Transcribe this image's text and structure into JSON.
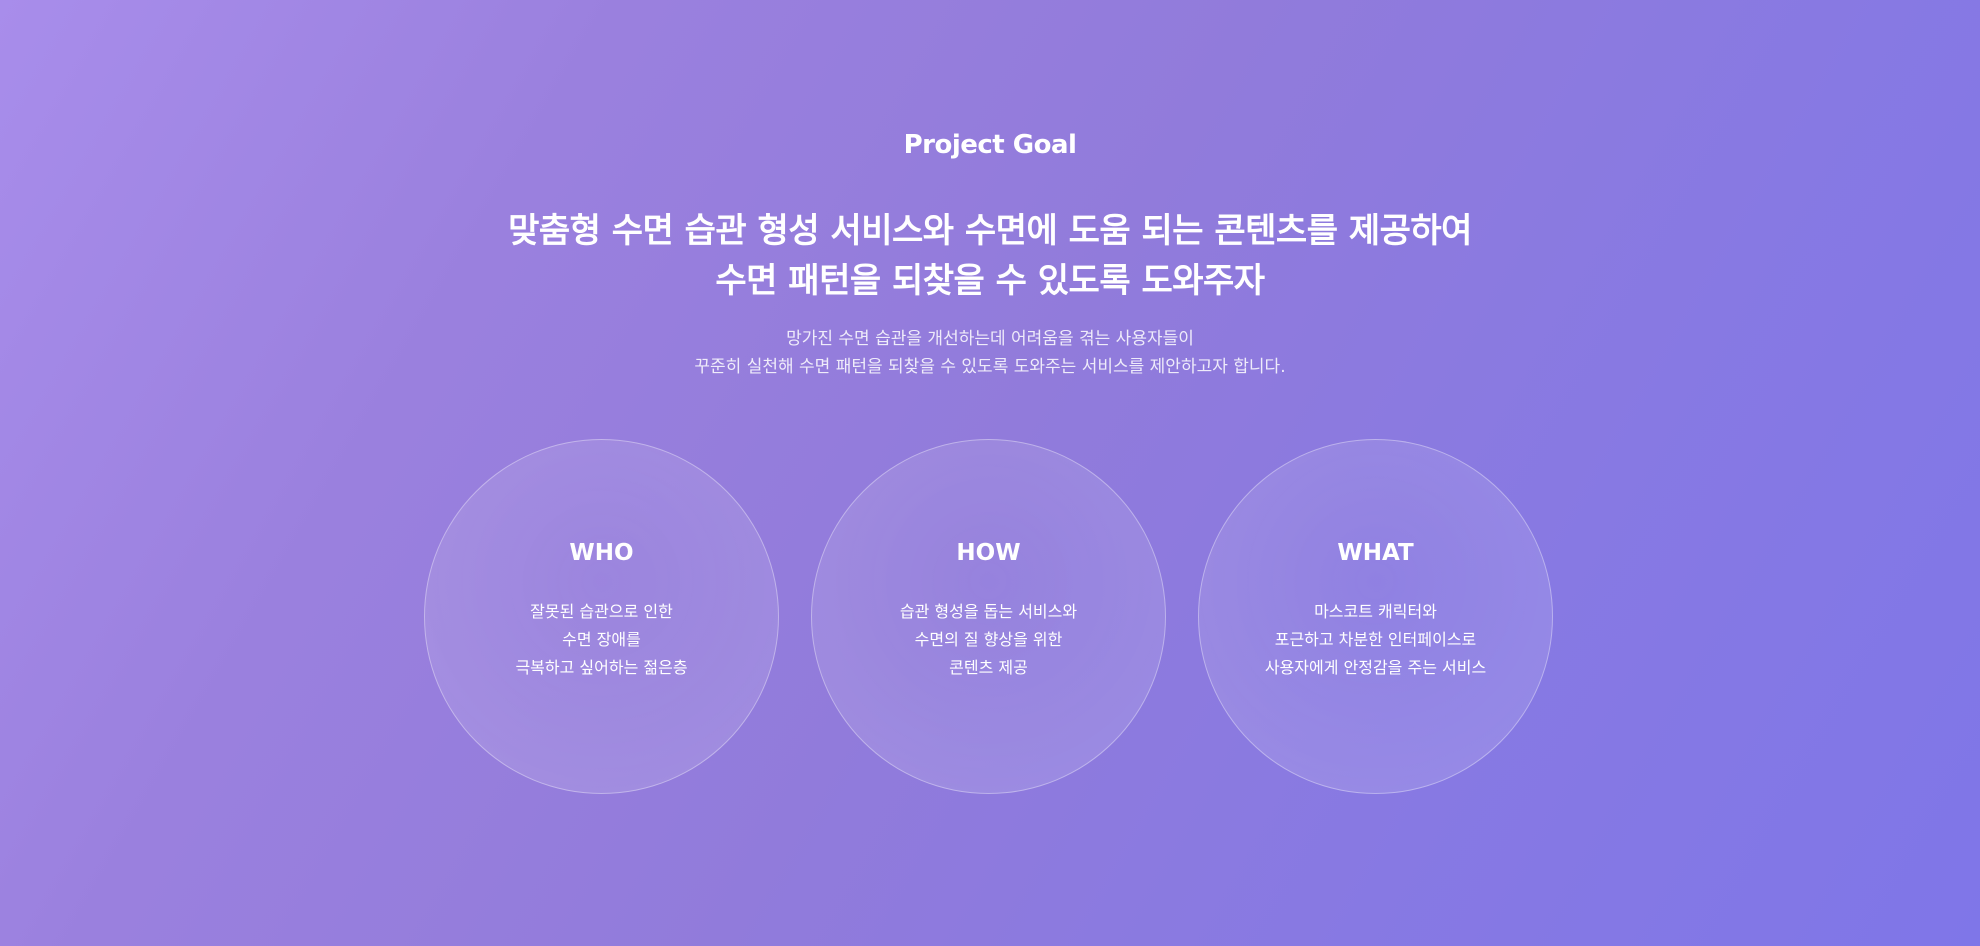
{
  "eyebrow": "Project Goal",
  "headline": {
    "line1": "맞춤형 수면 습관 형성 서비스와 수면에 도움 되는 콘텐츠를 제공하여",
    "line2": "수면 패턴을 되찾을 수 있도록 도와주자"
  },
  "intro": {
    "line1": "망가진 수면 습관을 개선하는데 어려움을 겪는 사용자들이",
    "line2": "꾸준히 실천해 수면 패턴을 되찾을 수 있도록 도와주는 서비스를 제안하고자 합니다."
  },
  "cards": [
    {
      "title": "WHO",
      "lines": [
        "잘못된 습관으로 인한",
        "수면 장애를",
        "극복하고 싶어하는 젊은층"
      ]
    },
    {
      "title": "HOW",
      "lines": [
        "습관 형성을 돕는 서비스와",
        "수면의 질 향상을 위한",
        "콘텐츠 제공"
      ]
    },
    {
      "title": "WHAT",
      "lines": [
        "마스코트 캐릭터와",
        "포근하고 차분한 인터페이스로",
        "사용자에게 안정감을 주는 서비스"
      ]
    }
  ],
  "colors": {
    "gradient_start": "#a88deb",
    "gradient_end": "#7f76e8",
    "text": "#ffffff"
  }
}
